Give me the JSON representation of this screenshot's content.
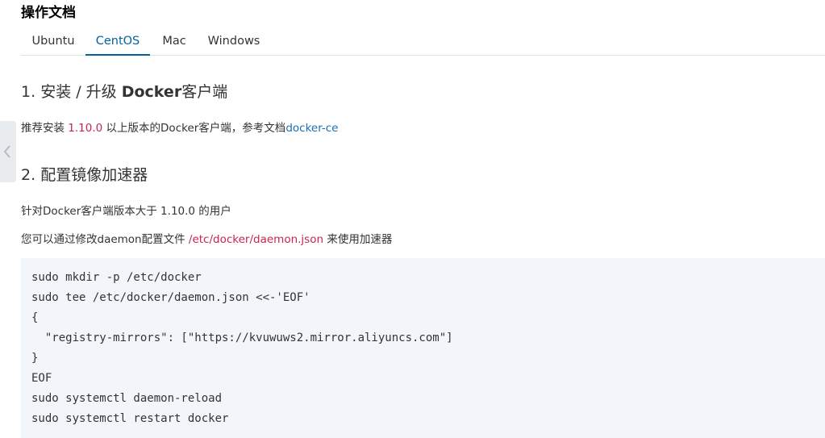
{
  "doc": {
    "title": "操作文档"
  },
  "tabs": [
    {
      "label": "Ubuntu"
    },
    {
      "label": "CentOS"
    },
    {
      "label": "Mac"
    },
    {
      "label": "Windows"
    }
  ],
  "section1": {
    "number": "1.",
    "prefix": "安装 / 升级",
    "bold": "Docker",
    "suffix": "客户端",
    "text_before": "推荐安装 ",
    "version": "1.10.0",
    "text_after": " 以上版本的Docker客户端，参考文档",
    "link": "docker-ce"
  },
  "section2": {
    "number": "2.",
    "title": "配置镜像加速器",
    "line1": "针对Docker客户端版本大于 1.10.0 的用户",
    "line2_before": "您可以通过修改daemon配置文件 ",
    "line2_path": "/etc/docker/daemon.json",
    "line2_after": " 来使用加速器"
  },
  "code": {
    "lines": [
      "sudo mkdir -p /etc/docker",
      "sudo tee /etc/docker/daemon.json <<-'EOF'",
      "{",
      "  \"registry-mirrors\": [\"https://kvuwuws2.mirror.aliyuncs.com\"]",
      "}",
      "EOF",
      "sudo systemctl daemon-reload",
      "sudo systemctl restart docker"
    ]
  },
  "colors": {
    "accent": "#00639f",
    "highlight": "#c7254e",
    "link": "#1a6fb4",
    "code_bg": "#f2f6fa"
  },
  "icons": {
    "side_handle": "chevron-left-icon"
  }
}
